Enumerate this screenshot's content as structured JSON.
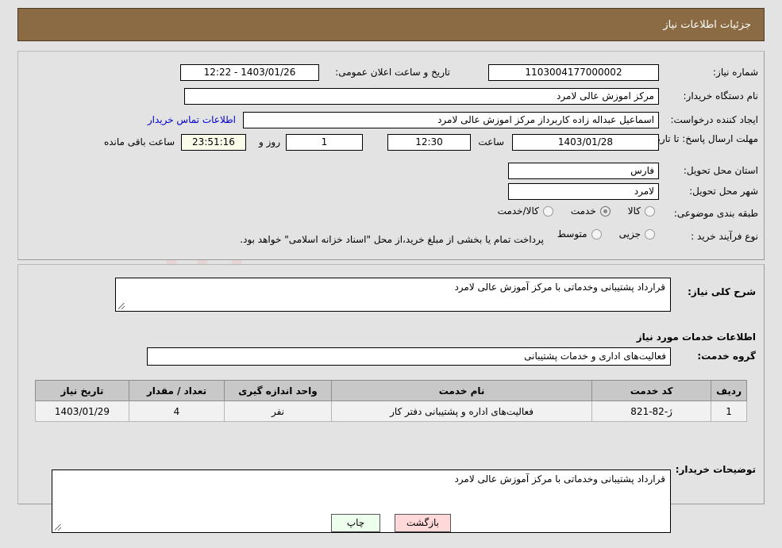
{
  "header": {
    "title": "جزئیات اطلاعات نیاز"
  },
  "top_form": {
    "need_number_label": "شماره نیاز:",
    "need_number_value": "1103004177000002",
    "announce_label": "تاریخ و ساعت اعلان عمومی:",
    "announce_value": "1403/01/26 - 12:22",
    "buyer_org_label": "نام دستگاه خریدار:",
    "buyer_org_value": "مرکز اموزش عالی لامرد",
    "creator_label": "ایجاد کننده درخواست:",
    "creator_value": "اسماعیل عبداله زاده کاربرداز مرکز اموزش عالی لامرد",
    "contact_link": "اطلاعات تماس خریدار",
    "deadline_label": "مهلت ارسال پاسخ: تا تاریخ:",
    "deadline_date": "1403/01/28",
    "hour_label": "ساعت",
    "hour_value": "12:30",
    "days_value": "1",
    "days_label": "روز و",
    "countdown_value": "23:51:16",
    "countdown_label": "ساعت باقی مانده",
    "province_label": "استان محل تحویل:",
    "province_value": "فارس",
    "city_label": "شهر محل تحویل:",
    "city_value": "لامرد",
    "category_label": "طبقه بندی موضوعی:",
    "category_options": [
      {
        "label": "کالا",
        "selected": false
      },
      {
        "label": "خدمت",
        "selected": true
      },
      {
        "label": "کالا/خدمت",
        "selected": false
      }
    ],
    "process_label": "نوع فرآیند خرید :",
    "process_options": [
      {
        "label": "جزیی",
        "selected": false
      },
      {
        "label": "متوسط",
        "selected": false
      }
    ],
    "treasury_note": "پرداخت تمام یا بخشی از مبلغ خرید،از محل \"اسناد خزانه اسلامی\" خواهد بود."
  },
  "middle": {
    "summary_label": "شرح کلی نیاز:",
    "summary_value": "قرارداد پشتیبانی وخدماتی با مرکز آموزش عالی لامرد",
    "services_heading": "اطلاعات خدمات مورد نیاز",
    "service_group_label": "گروه خدمت:",
    "service_group_value": "فعالیت‌های اداری و خدمات پشتیبانی",
    "table": {
      "columns": [
        "ردیف",
        "کد خدمت",
        "نام خدمت",
        "واحد اندازه گیری",
        "تعداد / مقدار",
        "تاریخ نیاز"
      ],
      "rows": [
        {
          "row_no": "1",
          "service_code": "ژ-82-821",
          "service_name": "فعالیت‌های اداره و پشتیبانی دفتر کار",
          "unit": "نفر",
          "quantity": "4",
          "need_date": "1403/01/29"
        }
      ]
    },
    "buyer_notes_label": "توضیحات خریدار:",
    "buyer_notes_value": "قرارداد پشتیبانی وخدماتی با مرکز آموزش عالی لامرد"
  },
  "buttons": {
    "print": "چاپ",
    "back": "بازگشت"
  },
  "colors": {
    "header_bg": "#8b6b43",
    "page_bg": "#e3e3e3",
    "link": "#0000cc",
    "countdown_bg": "#fbfbe9",
    "print_bg": "#edffed",
    "back_bg": "#ffd9d9"
  }
}
